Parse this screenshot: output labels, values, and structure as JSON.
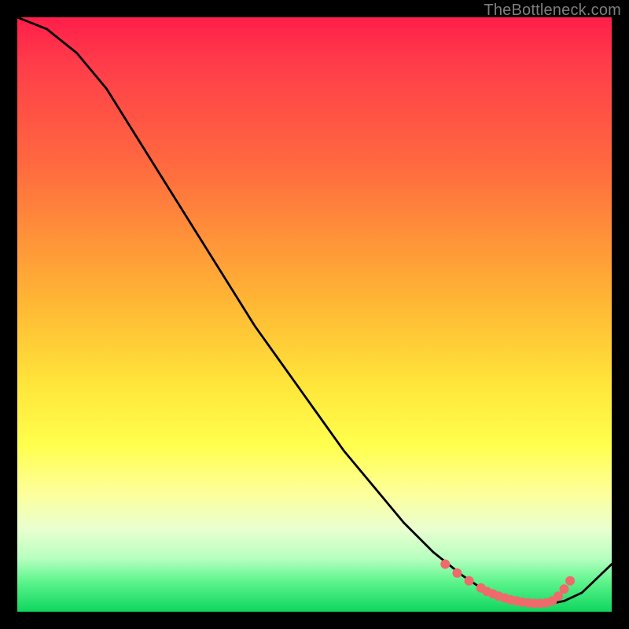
{
  "watermark": "TheBottleneck.com",
  "chart_data": {
    "type": "line",
    "title": "",
    "xlabel": "",
    "ylabel": "",
    "xlim": [
      0,
      100
    ],
    "ylim": [
      0,
      100
    ],
    "series": [
      {
        "name": "bottleneck-curve",
        "x": [
          0,
          5,
          10,
          15,
          20,
          25,
          30,
          35,
          40,
          45,
          50,
          55,
          60,
          65,
          70,
          75,
          78,
          80,
          82,
          85,
          88,
          90,
          92,
          95,
          100
        ],
        "y": [
          100,
          98,
          94,
          88,
          80,
          72,
          64,
          56,
          48,
          41,
          34,
          27,
          21,
          15,
          10,
          6,
          4,
          3,
          2.2,
          1.6,
          1.3,
          1.4,
          1.8,
          3.2,
          8
        ]
      }
    ],
    "markers": {
      "name": "highlight-dots",
      "color": "#ef6a6b",
      "x": [
        72,
        74,
        76,
        78,
        79,
        80,
        81,
        82,
        83,
        84,
        85,
        86,
        87,
        88,
        89,
        90,
        91,
        92,
        93
      ],
      "y": [
        8,
        6.5,
        5.2,
        4,
        3.4,
        3,
        2.6,
        2.3,
        2,
        1.8,
        1.6,
        1.5,
        1.4,
        1.4,
        1.5,
        1.8,
        2.6,
        3.8,
        5.2
      ]
    }
  }
}
